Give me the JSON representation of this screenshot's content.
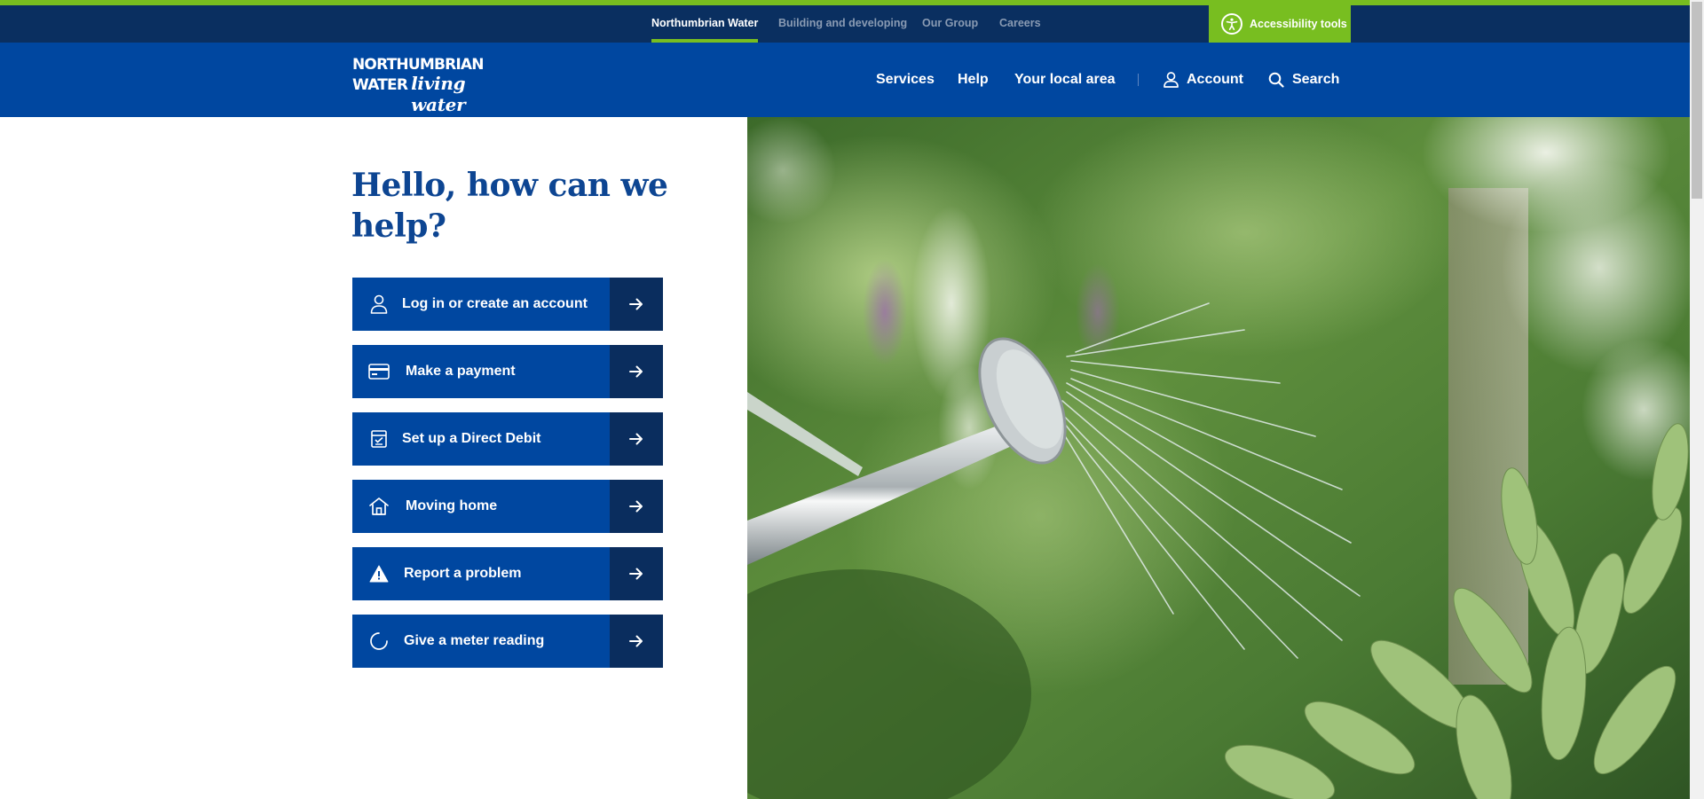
{
  "utility_nav": {
    "links": [
      {
        "label": "Northumbrian Water",
        "active": true
      },
      {
        "label": "Building and developing",
        "active": false
      },
      {
        "label": "Our Group",
        "active": false
      },
      {
        "label": "Careers",
        "active": false
      }
    ],
    "accessibility_label": "Accessibility tools"
  },
  "header": {
    "logo": {
      "line1": "NORTHUMBRIAN",
      "line2_word": "WATER",
      "tagline": "living water"
    },
    "nav": {
      "services": "Services",
      "help": "Help",
      "local_area": "Your local area",
      "account": "Account",
      "search": "Search"
    }
  },
  "main": {
    "title": "Hello, how can we help?",
    "actions": [
      {
        "label": "Log in or create an account",
        "icon": "user-icon"
      },
      {
        "label": "Make a payment",
        "icon": "card-icon"
      },
      {
        "label": "Set up a Direct Debit",
        "icon": "direct-debit-icon"
      },
      {
        "label": "Moving home",
        "icon": "home-icon"
      },
      {
        "label": "Report a problem",
        "icon": "warning-icon"
      },
      {
        "label": "Give a meter reading",
        "icon": "meter-icon"
      }
    ]
  },
  "colors": {
    "green_accent": "#78be20",
    "navy": "#0a2f60",
    "brand_blue": "#0047a0",
    "title_blue": "#0d4592"
  },
  "hero_image": {
    "subject": "watering-can-spraying-garden-plants"
  }
}
